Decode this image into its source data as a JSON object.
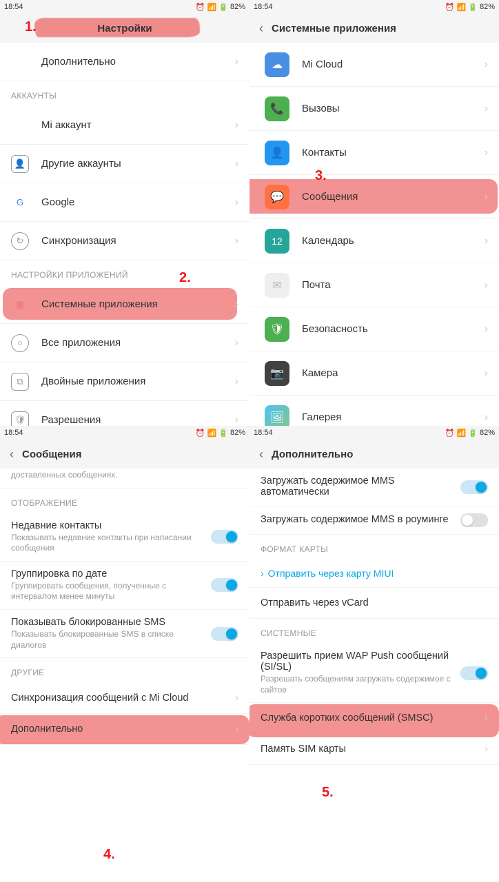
{
  "status": {
    "time": "18:54",
    "battery": "82%"
  },
  "annotations": [
    "1.",
    "2.",
    "3.",
    "4.",
    "5."
  ],
  "panel1": {
    "title": "Настройки",
    "row_more": "Дополнительно",
    "sect_accounts": "АККАУНТЫ",
    "row_mi_account": "Mi аккаунт",
    "row_other_acc": "Другие аккаунты",
    "row_google": "Google",
    "row_sync": "Синхронизация",
    "sect_apps": "НАСТРОЙКИ ПРИЛОЖЕНИЙ",
    "row_system_apps": "Системные приложения",
    "row_all_apps": "Все приложения",
    "row_dual_apps": "Двойные приложения",
    "row_permissions": "Разрешения"
  },
  "panel2": {
    "title": "Системные приложения",
    "apps": {
      "micloud": "Mi Cloud",
      "calls": "Вызовы",
      "contacts": "Контакты",
      "messages": "Сообщения",
      "calendar": "Календарь",
      "mail": "Почта",
      "security": "Безопасность",
      "camera": "Камера",
      "gallery": "Галерея"
    }
  },
  "panel3": {
    "title": "Сообщения",
    "partial_sub": "доставленных сообщениях.",
    "sect_display": "ОТОБРАЖЕНИЕ",
    "recent_t": "Недавние контакты",
    "recent_s": "Показывать недавние контакты при написании сообщения",
    "group_t": "Группировка по дате",
    "group_s": "Группировать сообщения, полученные с интервалом менее минуты",
    "blocked_t": "Показывать блокированные SMS",
    "blocked_s": "Показывать блокированные SMS в списке диалогов",
    "sect_other": "ДРУГИЕ",
    "sync_mi": "Синхронизация сообщений с Mi Cloud",
    "more": "Дополнительно"
  },
  "panel4": {
    "title": "Дополнительно",
    "mms_auto": "Загружать содержимое MMS автоматически",
    "mms_roam": "Загружать содержимое MMS в роуминге",
    "sect_card": "ФОРМАТ КАРТЫ",
    "send_miui": "Отправить через карту MIUI",
    "send_vcard": "Отправить через vCard",
    "sect_system": "СИСТЕМНЫЕ",
    "wap_t": "Разрешить прием WAP Push сообщений (SI/SL)",
    "wap_s": "Разрешать сообщениям загружать содержимое с сайтов",
    "smsc": "Служба коротких сообщений (SMSC)",
    "sim_mem": "Память SIM карты"
  }
}
